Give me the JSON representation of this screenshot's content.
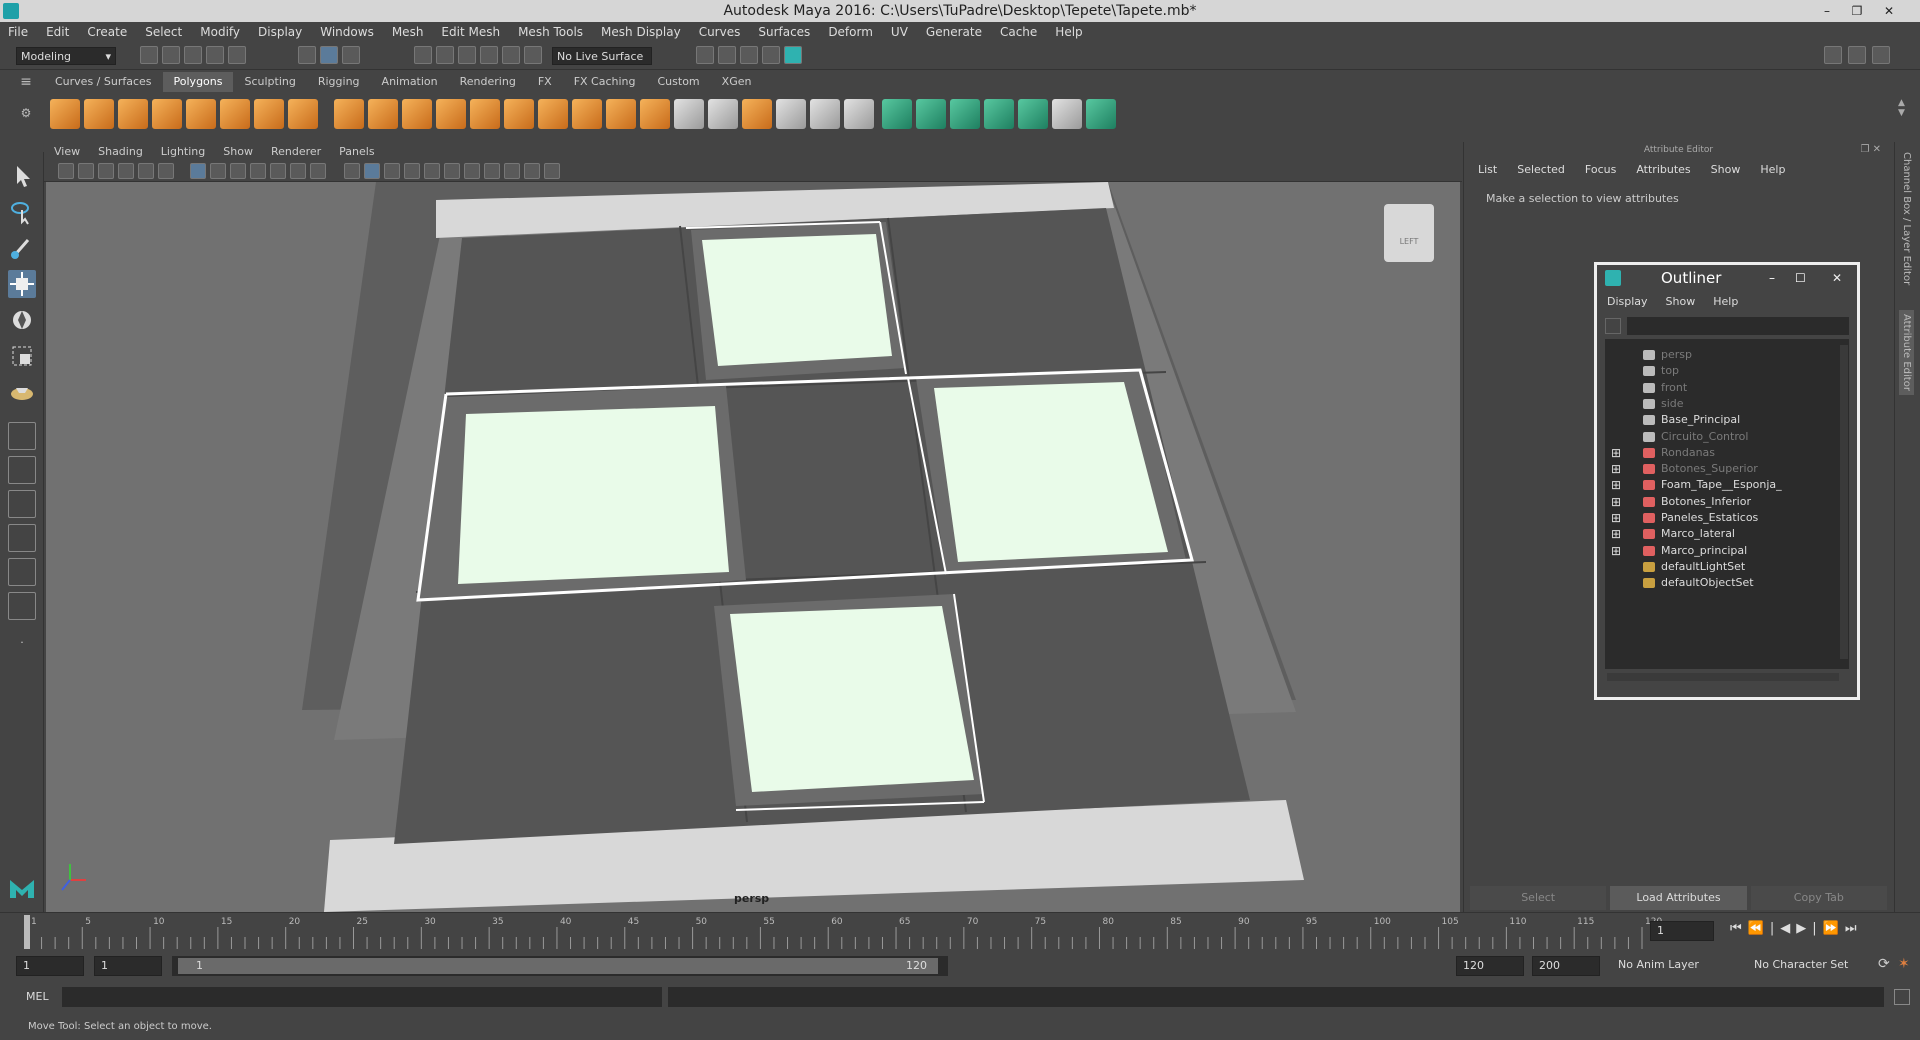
{
  "window": {
    "title": "Autodesk Maya 2016: C:\\Users\\TuPadre\\Desktop\\Tepete\\Tapete.mb*"
  },
  "menubar": [
    "File",
    "Edit",
    "Create",
    "Select",
    "Modify",
    "Display",
    "Windows",
    "Mesh",
    "Edit Mesh",
    "Mesh Tools",
    "Mesh Display",
    "Curves",
    "Surfaces",
    "Deform",
    "UV",
    "Generate",
    "Cache",
    "Help"
  ],
  "status": {
    "mode": "Modeling",
    "live_surface": "No Live Surface"
  },
  "shelf_tabs": [
    {
      "label": "Curves / Surfaces",
      "selected": false
    },
    {
      "label": "Polygons",
      "selected": true
    },
    {
      "label": "Sculpting",
      "selected": false
    },
    {
      "label": "Rigging",
      "selected": false
    },
    {
      "label": "Animation",
      "selected": false
    },
    {
      "label": "Rendering",
      "selected": false
    },
    {
      "label": "FX",
      "selected": false
    },
    {
      "label": "FX Caching",
      "selected": false
    },
    {
      "label": "Custom",
      "selected": false
    },
    {
      "label": "XGen",
      "selected": false
    }
  ],
  "viewport": {
    "menu": [
      "View",
      "Shading",
      "Lighting",
      "Show",
      "Renderer",
      "Panels"
    ],
    "camera": "persp",
    "viewcube": "LEFT"
  },
  "attribute_editor": {
    "header": "Attribute Editor",
    "menu": [
      "List",
      "Selected",
      "Focus",
      "Attributes",
      "Show",
      "Help"
    ],
    "message": "Make a selection to view attributes",
    "buttons": [
      "Select",
      "Load Attributes",
      "Copy Tab"
    ]
  },
  "side_tabs": [
    "Channel Box / Layer Editor",
    "Attribute Editor"
  ],
  "outliner": {
    "title": "Outliner",
    "menu": [
      "Display",
      "Show",
      "Help"
    ],
    "items": [
      {
        "name": "persp",
        "icon": "camera-icon",
        "expandable": false,
        "dim": true
      },
      {
        "name": "top",
        "icon": "camera-icon",
        "expandable": false,
        "dim": true
      },
      {
        "name": "front",
        "icon": "camera-icon",
        "expandable": false,
        "dim": true
      },
      {
        "name": "side",
        "icon": "camera-icon",
        "expandable": false,
        "dim": true
      },
      {
        "name": "Base_Principal",
        "icon": "curve-icon",
        "expandable": false,
        "dim": false
      },
      {
        "name": "Circuito_Control",
        "icon": "curve-icon",
        "expandable": false,
        "dim": true
      },
      {
        "name": "Rondanas",
        "icon": "group-icon",
        "expandable": true,
        "dim": true
      },
      {
        "name": "Botones_Superior",
        "icon": "group-icon",
        "expandable": true,
        "dim": true
      },
      {
        "name": "Foam_Tape__Esponja_",
        "icon": "group-icon",
        "expandable": true,
        "dim": false
      },
      {
        "name": "Botones_Inferior",
        "icon": "group-icon",
        "expandable": true,
        "dim": false
      },
      {
        "name": "Paneles_Estaticos",
        "icon": "group-icon",
        "expandable": true,
        "dim": false
      },
      {
        "name": "Marco_lateral",
        "icon": "group-icon",
        "expandable": true,
        "dim": false
      },
      {
        "name": "Marco_principal",
        "icon": "group-icon",
        "expandable": true,
        "dim": false
      },
      {
        "name": "defaultLightSet",
        "icon": "set-icon",
        "expandable": false,
        "dim": false
      },
      {
        "name": "defaultObjectSet",
        "icon": "set-icon",
        "expandable": false,
        "dim": false
      }
    ]
  },
  "timeline": {
    "ticks": [
      "1",
      "5",
      "10",
      "15",
      "20",
      "25",
      "30",
      "35",
      "40",
      "45",
      "50",
      "55",
      "60",
      "65",
      "70",
      "75",
      "80",
      "85",
      "90",
      "95",
      "100",
      "105",
      "110",
      "115",
      "120"
    ],
    "current_frame": "1"
  },
  "range": {
    "start": "1",
    "playback_start": "1",
    "slider_start": "1",
    "slider_end": "120",
    "playback_end": "120",
    "end": "200",
    "anim_layer": "No Anim Layer",
    "character_set": "No Character Set"
  },
  "command": {
    "language": "MEL"
  },
  "help_line": "Move Tool: Select an object to move.",
  "colors": {
    "bg": "#444444",
    "viewport": "#717171",
    "panel_fill": "#e9fbe9",
    "accent": "#2fb2b0"
  }
}
